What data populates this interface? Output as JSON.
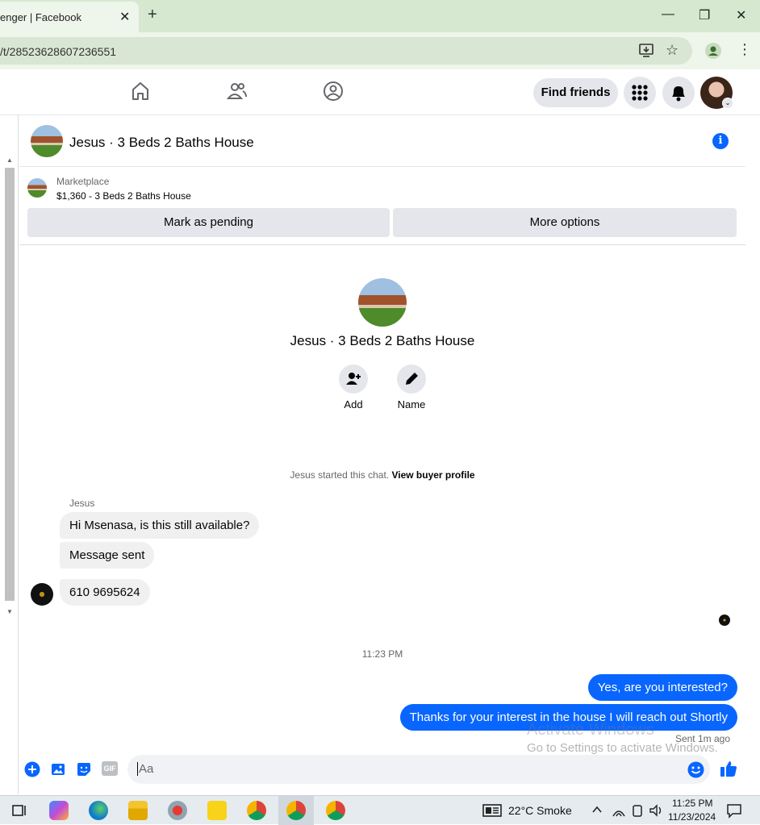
{
  "browser": {
    "tab_title": "enger | Facebook",
    "tab_close": "✕",
    "new_tab": "+",
    "window": {
      "minimize": "—",
      "restore": "❐",
      "close": "✕"
    },
    "url": "/t/28523628607236551",
    "star": "☆",
    "kebab": "⋮"
  },
  "fb_nav": {
    "icons": [
      "home-icon",
      "friends-icon",
      "groups-icon"
    ],
    "find_friends": "Find friends",
    "menu_icon": "grid-menu-icon",
    "notifications_icon": "bell-icon",
    "avatar_caret": "⌄"
  },
  "chat_header": {
    "title": "Jesus · 3 Beds 2 Baths House",
    "info": "i"
  },
  "marketplace": {
    "label": "Marketplace",
    "listing": "$1,360 - 3 Beds 2 Baths House",
    "mark_pending": "Mark as pending",
    "more_options": "More options"
  },
  "intro": {
    "title": "Jesus · 3 Beds 2 Baths House",
    "add_label": "Add",
    "name_label": "Name"
  },
  "system_message": {
    "text": "Jesus started this chat. ",
    "link": "View buyer profile"
  },
  "messages_in": {
    "sender": "Jesus",
    "items": [
      "Hi Msenasa, is this still available?",
      "Message sent",
      "610 9695624"
    ]
  },
  "timestamp": "11:23 PM",
  "messages_out": {
    "items": [
      "Yes, are you interested?",
      "Thanks for your interest in the house I will reach out Shortly"
    ],
    "status": "Sent 1m ago"
  },
  "watermark": {
    "line1": "Activate Windows",
    "line2": "Go to Settings to activate Windows."
  },
  "composer": {
    "placeholder": "Aa",
    "icons": [
      "plus-circle-icon",
      "photo-icon",
      "sticker-icon",
      "gif-icon",
      "emoji-icon",
      "like-icon"
    ],
    "gif_label": "GIF"
  },
  "taskbar": {
    "weather": "22°C  Smoke",
    "time": "11:25 PM",
    "date": "11/23/2024",
    "colors": {
      "accent": "#0866ff"
    }
  },
  "scrollbar": {
    "up": "▲",
    "down": "▼"
  }
}
